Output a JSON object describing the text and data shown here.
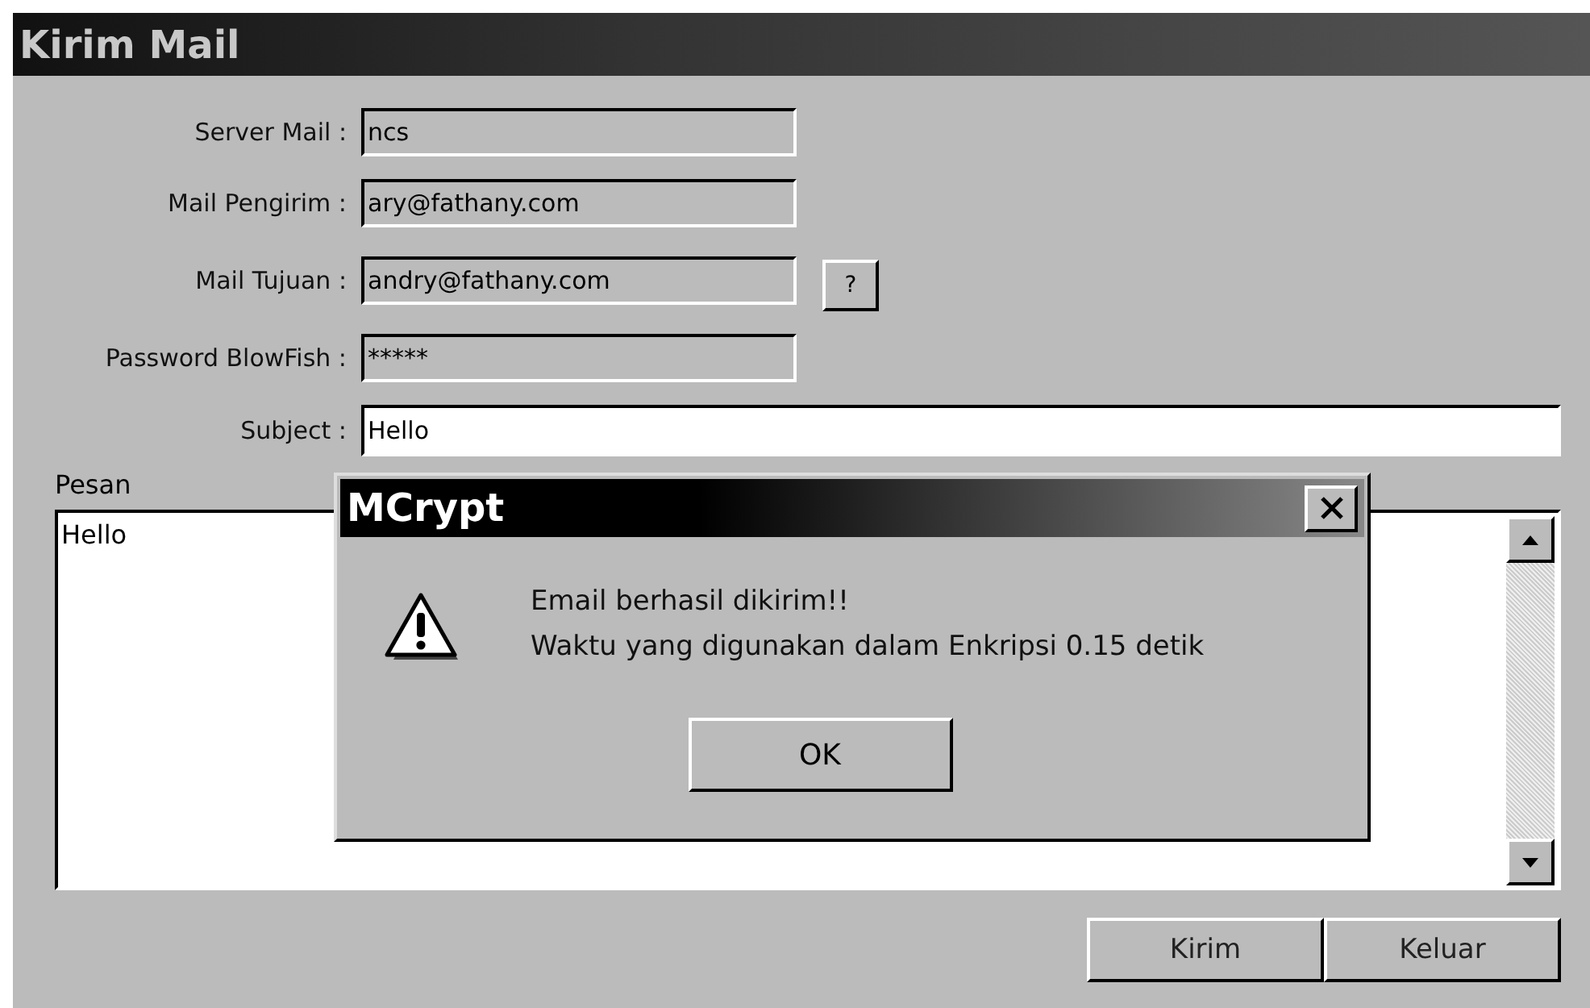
{
  "window": {
    "title": "Kirim Mail"
  },
  "fields": [
    {
      "label": "Server Mail :",
      "value": "ncs",
      "readonly": true
    },
    {
      "label": "Mail Pengirim :",
      "value": "ary@fathany.com",
      "readonly": true
    },
    {
      "label": "Mail Tujuan :",
      "value": "andry@fathany.com",
      "readonly": true,
      "button": "?"
    },
    {
      "label": "Password BlowFish :",
      "value": "*****",
      "readonly": true
    },
    {
      "label": "Subject :",
      "value": "Hello",
      "readonly": false
    }
  ],
  "message": {
    "label": "Pesan",
    "value": "Hello"
  },
  "buttons": [
    {
      "label": "Kirim"
    },
    {
      "label": "Keluar"
    }
  ],
  "dialog": {
    "title": "MCrypt",
    "lines": [
      "Email berhasil dikirim!!",
      "Waktu yang digunakan dalam Enkripsi 0.15 detik"
    ],
    "button": "OK"
  }
}
